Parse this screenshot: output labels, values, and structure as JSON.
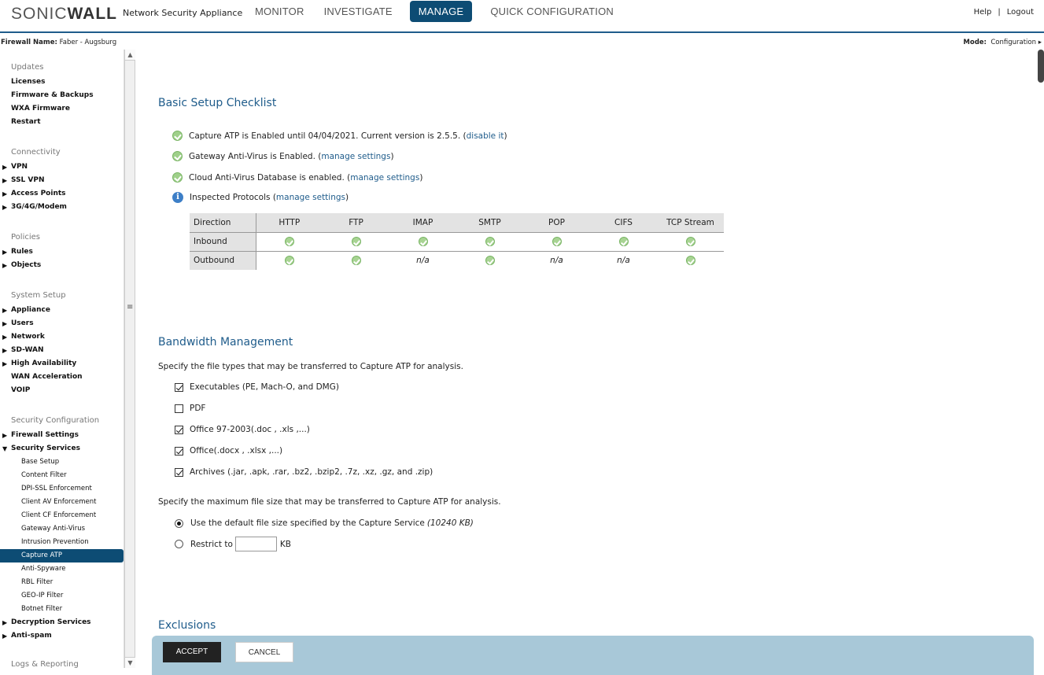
{
  "header": {
    "brand": "SONICWALL",
    "brand_sub": "Network Security Appliance",
    "nav": [
      "MONITOR",
      "INVESTIGATE",
      "MANAGE",
      "QUICK CONFIGURATION"
    ],
    "help": "Help",
    "sep": "|",
    "logout": "Logout"
  },
  "firewall": {
    "label": "Firewall Name:",
    "name": "Faber - Augsburg"
  },
  "mode": {
    "label": "Mode:",
    "value": "Configuration"
  },
  "sidebar": {
    "updates_title": "Updates",
    "updates": [
      "Licenses",
      "Firmware & Backups",
      "WXA Firmware",
      "Restart"
    ],
    "connectivity_title": "Connectivity",
    "connectivity": [
      "VPN",
      "SSL VPN",
      "Access Points",
      "3G/4G/Modem"
    ],
    "policies_title": "Policies",
    "policies": [
      "Rules",
      "Objects"
    ],
    "system_title": "System Setup",
    "system": [
      "Appliance",
      "Users",
      "Network",
      "SD-WAN",
      "High Availability",
      "WAN Acceleration",
      "VOIP"
    ],
    "security_title": "Security Configuration",
    "firewall_settings": "Firewall Settings",
    "security_services": "Security Services",
    "security_sub": [
      "Base Setup",
      "Content Filter",
      "DPI-SSL Enforcement",
      "Client AV Enforcement",
      "Client CF Enforcement",
      "Gateway Anti-Virus",
      "Intrusion Prevention",
      "Capture ATP",
      "Anti-Spyware",
      "RBL Filter",
      "GEO-IP Filter",
      "Botnet Filter"
    ],
    "decryption": "Decryption Services",
    "antispam": "Anti-spam",
    "logs_title": "Logs & Reporting"
  },
  "checklist": {
    "title": "Basic Setup Checklist",
    "line1_text": "Capture ATP is Enabled until 04/04/2021. Current version is 2.5.5. (",
    "line1_link": "disable it",
    "line2_text": "Gateway Anti-Virus is Enabled. (",
    "line2_link": "manage settings",
    "line3_text": "Cloud Anti-Virus Database is enabled. (",
    "line3_link": "manage settings",
    "line4_text": "Inspected Protocols (",
    "line4_link": "manage settings",
    "close_paren": ")"
  },
  "protocols": {
    "headers": [
      "Direction",
      "HTTP",
      "FTP",
      "IMAP",
      "SMTP",
      "POP",
      "CIFS",
      "TCP Stream"
    ],
    "inbound_label": "Inbound",
    "outbound_label": "Outbound",
    "inbound": [
      "ok",
      "ok",
      "ok",
      "ok",
      "ok",
      "ok",
      "ok"
    ],
    "outbound": [
      "ok",
      "ok",
      "n/a",
      "ok",
      "n/a",
      "n/a",
      "ok"
    ],
    "na_text": "n/a"
  },
  "bandwidth": {
    "title": "Bandwidth Management",
    "filetypes_desc": "Specify the file types that may be transferred to Capture ATP for analysis.",
    "filetypes": [
      {
        "label": "Executables (PE, Mach-O, and DMG)",
        "checked": true
      },
      {
        "label": "PDF",
        "checked": false
      },
      {
        "label": "Office 97-2003(.doc , .xls ,...)",
        "checked": true
      },
      {
        "label": "Office(.docx , .xlsx ,...)",
        "checked": true
      },
      {
        "label": "Archives (.jar, .apk, .rar, .bz2, .bzip2, .7z, .xz, .gz, and .zip)",
        "checked": true
      }
    ],
    "size_desc": "Specify the maximum file size that may be transferred to Capture ATP for analysis.",
    "default_size_label": "Use the default file size specified by the Capture Service ",
    "default_size_value": "(10240 KB)",
    "restrict_label": "Restrict to",
    "restrict_value": "",
    "restrict_unit": "KB"
  },
  "exclusions": {
    "title": "Exclusions"
  },
  "actions": {
    "accept": "ACCEPT",
    "cancel": "CANCEL"
  }
}
